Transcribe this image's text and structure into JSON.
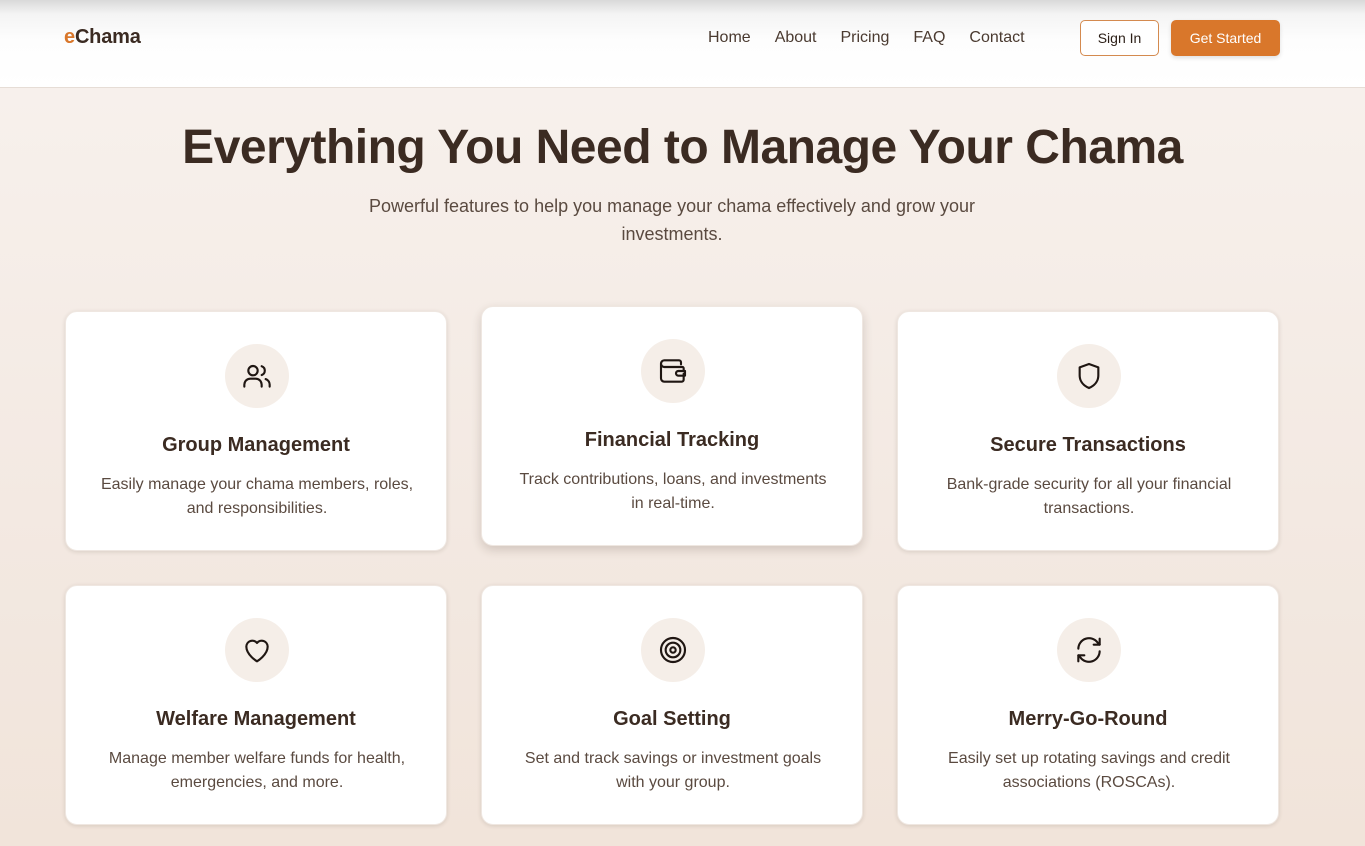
{
  "brand": {
    "prefix": "e",
    "name": "Chama",
    "accent_color": "#d9772b"
  },
  "nav": {
    "links": [
      "Home",
      "About",
      "Pricing",
      "FAQ",
      "Contact"
    ],
    "sign_in": "Sign In",
    "get_started": "Get Started"
  },
  "hero": {
    "title": "Everything You Need to Manage Your Chama",
    "subtitle": "Powerful features to help you manage your chama effectively and grow your investments."
  },
  "features": [
    {
      "icon": "users-icon",
      "title": "Group Management",
      "description": "Easily manage your chama members, roles, and responsibilities."
    },
    {
      "icon": "wallet-icon",
      "title": "Financial Tracking",
      "description": "Track contributions, loans, and investments in real-time."
    },
    {
      "icon": "shield-icon",
      "title": "Secure Transactions",
      "description": "Bank-grade security for all your financial transactions."
    },
    {
      "icon": "heart-icon",
      "title": "Welfare Management",
      "description": "Manage member welfare funds for health, emergencies, and more."
    },
    {
      "icon": "target-icon",
      "title": "Goal Setting",
      "description": "Set and track savings or investment goals with your group."
    },
    {
      "icon": "refresh-icon",
      "title": "Merry-Go-Round",
      "description": "Easily set up rotating savings and credit associations (ROSCAs)."
    }
  ]
}
